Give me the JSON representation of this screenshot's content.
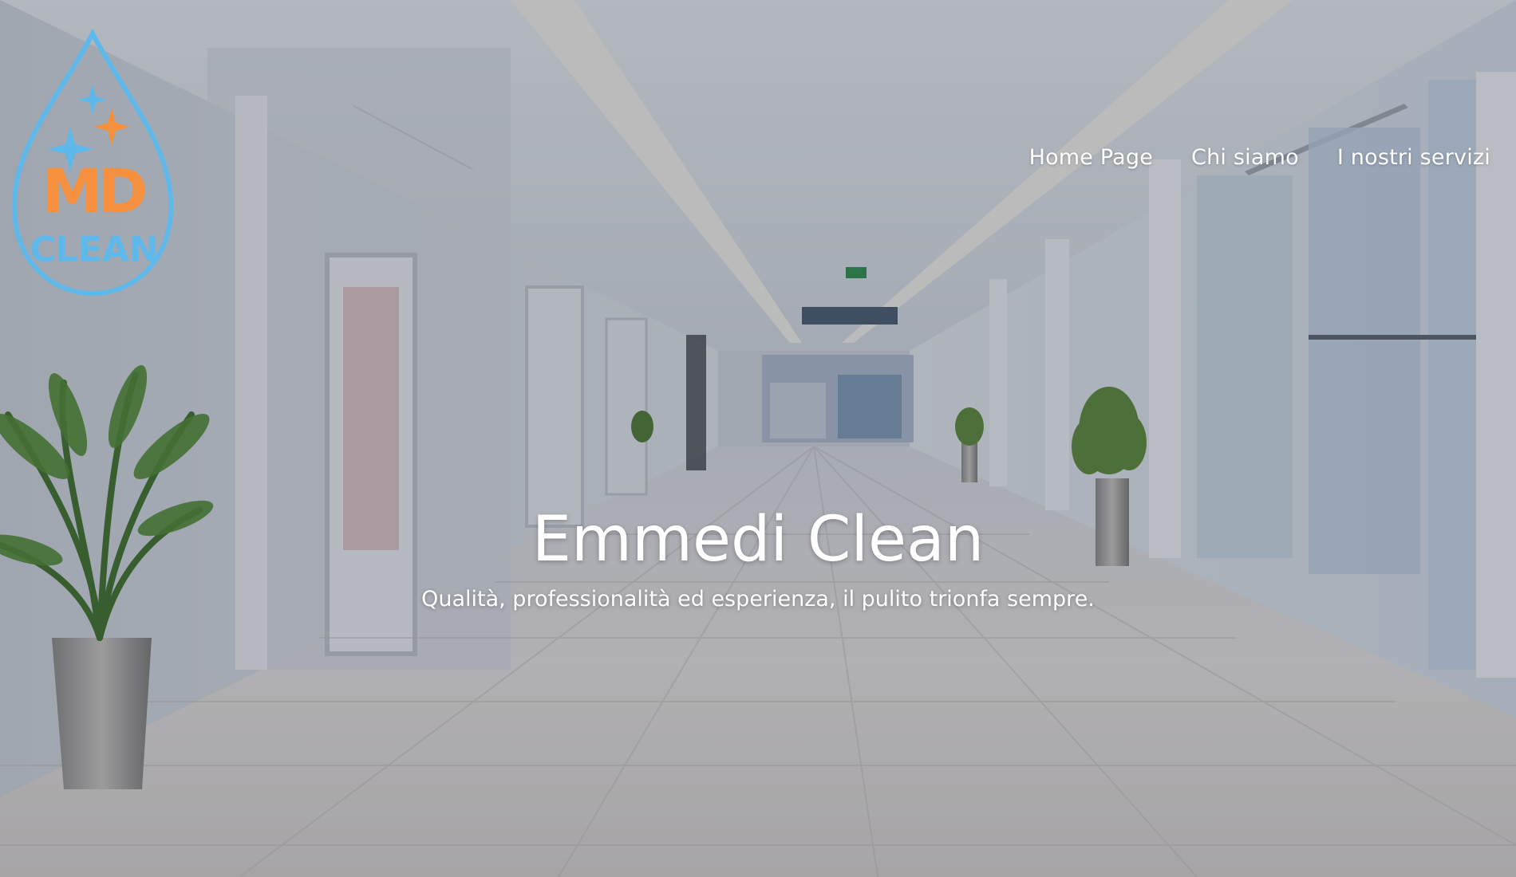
{
  "brand": {
    "logo_top": "MD",
    "logo_bottom": "CLEAN",
    "colors": {
      "blue": "#5fb8ea",
      "orange": "#f5913e"
    }
  },
  "nav": {
    "items": [
      {
        "label": "Home Page"
      },
      {
        "label": "Chi siamo"
      },
      {
        "label": "I nostri servizi"
      }
    ]
  },
  "hero": {
    "title": "Emmedi Clean",
    "subtitle": "Qualità, professionalità ed esperienza, il pulito trionfa sempre.",
    "background": "shopping-mall-corridor-photo"
  }
}
